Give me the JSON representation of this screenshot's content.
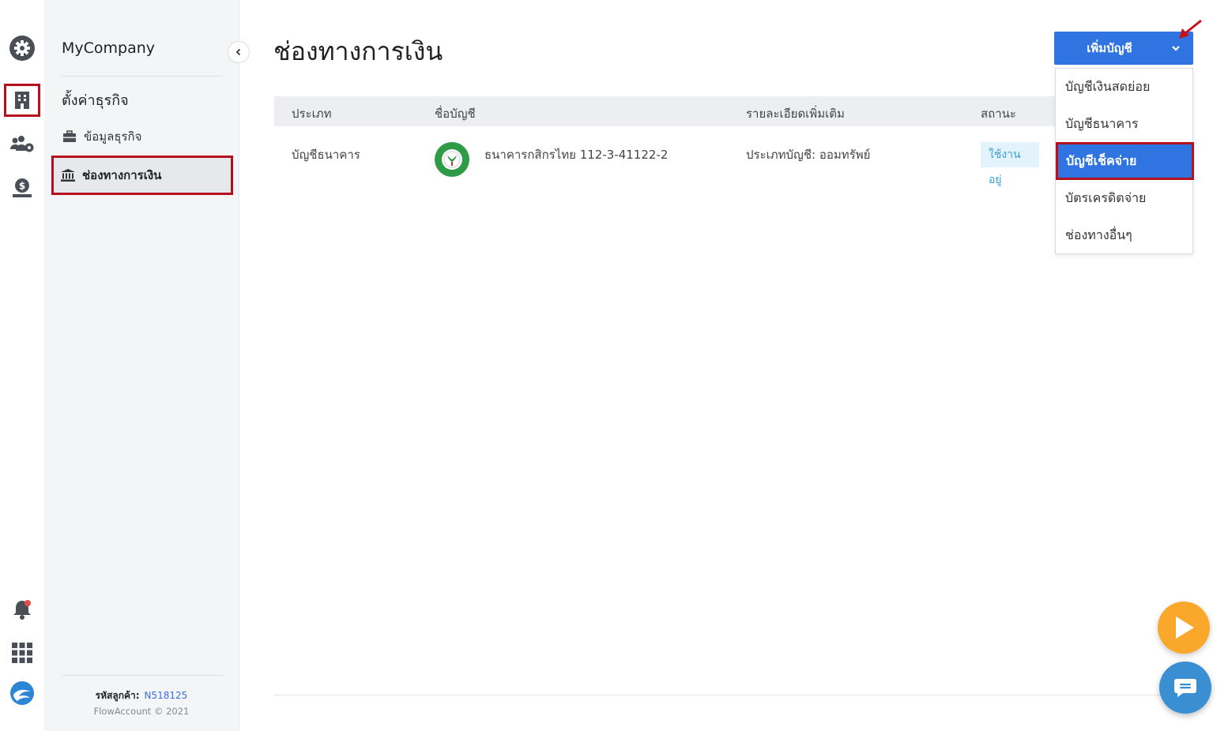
{
  "rail": {
    "items": [
      {
        "name": "settings-gear-icon"
      },
      {
        "name": "building-icon",
        "active": true
      },
      {
        "name": "users-gear-icon"
      },
      {
        "name": "money-hand-icon"
      },
      {
        "name": "bell-icon"
      },
      {
        "name": "apps-grid-icon"
      },
      {
        "name": "flowaccount-logo-icon"
      }
    ]
  },
  "sidebar": {
    "company": "MyCompany",
    "heading": "ตั้งค่าธุรกิจ",
    "items": [
      {
        "label": "ข้อมูลธุรกิจ",
        "icon": "briefcase-icon"
      },
      {
        "label": "ช่องทางการเงิน",
        "icon": "bank-icon",
        "active": true
      }
    ],
    "customer_label": "รหัสลูกค้า:",
    "customer_code": "N518125",
    "copyright": "FlowAccount © 2021"
  },
  "main": {
    "title": "ช่องทางการเงิน",
    "columns": [
      "ประเภท",
      "ชื่อบัญชี",
      "รายละเอียดเพิ่มเติม",
      "สถานะ"
    ],
    "rows": [
      {
        "type": "บัญชีธนาคาร",
        "name": "ธนาคารกสิกรไทย 112-3-41122-2",
        "detail": "ประเภทบัญชี: ออมทรัพย์",
        "status": "ใช้งานอยู่"
      }
    ]
  },
  "add_button": {
    "label": "เพิ่มบัญชี",
    "menu": [
      {
        "label": "บัญชีเงินสดย่อย"
      },
      {
        "label": "บัญชีธนาคาร"
      },
      {
        "label": "บัญชีเช็คจ่าย",
        "active": true
      },
      {
        "label": "บัตรเครดิตจ่าย"
      },
      {
        "label": "ช่องทางอื่นๆ"
      }
    ]
  },
  "colors": {
    "primary": "#2f74e0",
    "highlight_border": "#b5101d",
    "status_text": "#3aa0d8",
    "bank_green": "#2e9b47",
    "play_orange": "#f9a82c",
    "chat_blue": "#3a8fd3"
  }
}
